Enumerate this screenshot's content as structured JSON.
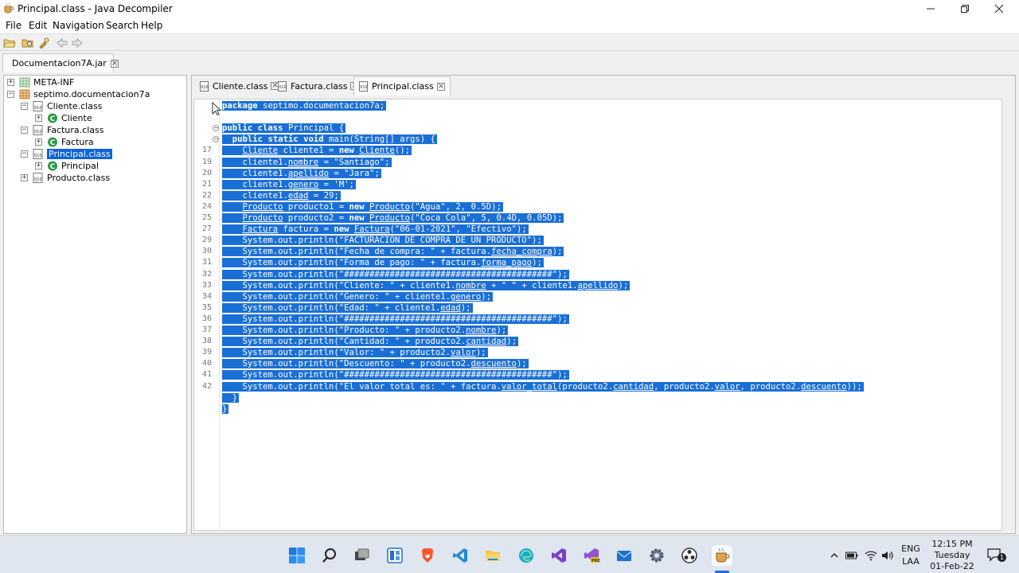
{
  "window": {
    "title": "Principal.class - Java Decompiler"
  },
  "menu": [
    "File",
    "Edit",
    "Navigation",
    "Search",
    "Help"
  ],
  "jar_tab": {
    "label": "Documentacion7A.jar"
  },
  "tree": {
    "items": [
      {
        "label": "META-INF"
      },
      {
        "label": "septimo.documentacion7a"
      },
      {
        "label": "Cliente.class"
      },
      {
        "label": "Cliente"
      },
      {
        "label": "Factura.class"
      },
      {
        "label": "Factura"
      },
      {
        "label": "Principal.class"
      },
      {
        "label": "Principal"
      },
      {
        "label": "Producto.class"
      }
    ]
  },
  "file_tabs": [
    "Cliente.class",
    "Factura.class",
    "Principal.class"
  ],
  "code": {
    "lines": [
      {
        "no": "",
        "text": "package septimo.documentacion7a;"
      },
      {
        "no": "",
        "text": ""
      },
      {
        "no": "",
        "text": "public class Principal {"
      },
      {
        "no": "",
        "text": "  public static void main(String[] args) {"
      },
      {
        "no": "17",
        "text": "    Cliente cliente1 = new Cliente();"
      },
      {
        "no": "19",
        "text": "    cliente1.nombre = \"Santiago\";"
      },
      {
        "no": "20",
        "text": "    cliente1.apellido = \"Jara\";"
      },
      {
        "no": "21",
        "text": "    cliente1.genero = 'M';"
      },
      {
        "no": "22",
        "text": "    cliente1.edad = 29;"
      },
      {
        "no": "24",
        "text": "    Producto producto1 = new Producto(\"Agua\", 2, 0.5D);"
      },
      {
        "no": "25",
        "text": "    Producto producto2 = new Producto(\"Coca Cola\", 5, 0.4D, 0.05D);"
      },
      {
        "no": "27",
        "text": "    Factura factura = new Factura(\"06-01-2021\", \"Efectivo\");"
      },
      {
        "no": "29",
        "text": "    System.out.println(\"FACTURACIÓN DE COMPRA DE UN PRODUCTO\");"
      },
      {
        "no": "30",
        "text": "    System.out.println(\"Fecha de compra: \" + factura.fecha_compra);"
      },
      {
        "no": "31",
        "text": "    System.out.println(\"Forma de pago: \" + factura.forma_pago);"
      },
      {
        "no": "32",
        "text": "    System.out.println(\"#########################################\");"
      },
      {
        "no": "33",
        "text": "    System.out.println(\"Cliente: \" + cliente1.nombre + \" \" + cliente1.apellido);"
      },
      {
        "no": "34",
        "text": "    System.out.println(\"Genero: \" + cliente1.genero);"
      },
      {
        "no": "35",
        "text": "    System.out.println(\"Edad: \" + cliente1.edad);"
      },
      {
        "no": "36",
        "text": "    System.out.println(\"#########################################\");"
      },
      {
        "no": "37",
        "text": "    System.out.println(\"Producto: \" + producto2.nombre);"
      },
      {
        "no": "38",
        "text": "    System.out.println(\"Cantidad: \" + producto2.cantidad);"
      },
      {
        "no": "39",
        "text": "    System.out.println(\"Valor: \" + producto2.valor);"
      },
      {
        "no": "40",
        "text": "    System.out.println(\"Descuento: \" + producto2.descuento);"
      },
      {
        "no": "41",
        "text": "    System.out.println(\"#########################################\");"
      },
      {
        "no": "42",
        "text": "    System.out.println(\"El valor total es: \" + factura.valor_total(producto2.cantidad, producto2.valor, producto2.descuento));"
      },
      {
        "no": "",
        "text": "  }"
      },
      {
        "no": "",
        "text": "}"
      }
    ]
  },
  "tray": {
    "lang1": "ENG",
    "lang2": "LAA",
    "time": "12:15 PM",
    "day": "Tuesday",
    "date": "01-Feb-22",
    "notifications": "1"
  },
  "colors": {
    "selection": "#1a6fd6",
    "taskbar": "#dfe6f0"
  }
}
